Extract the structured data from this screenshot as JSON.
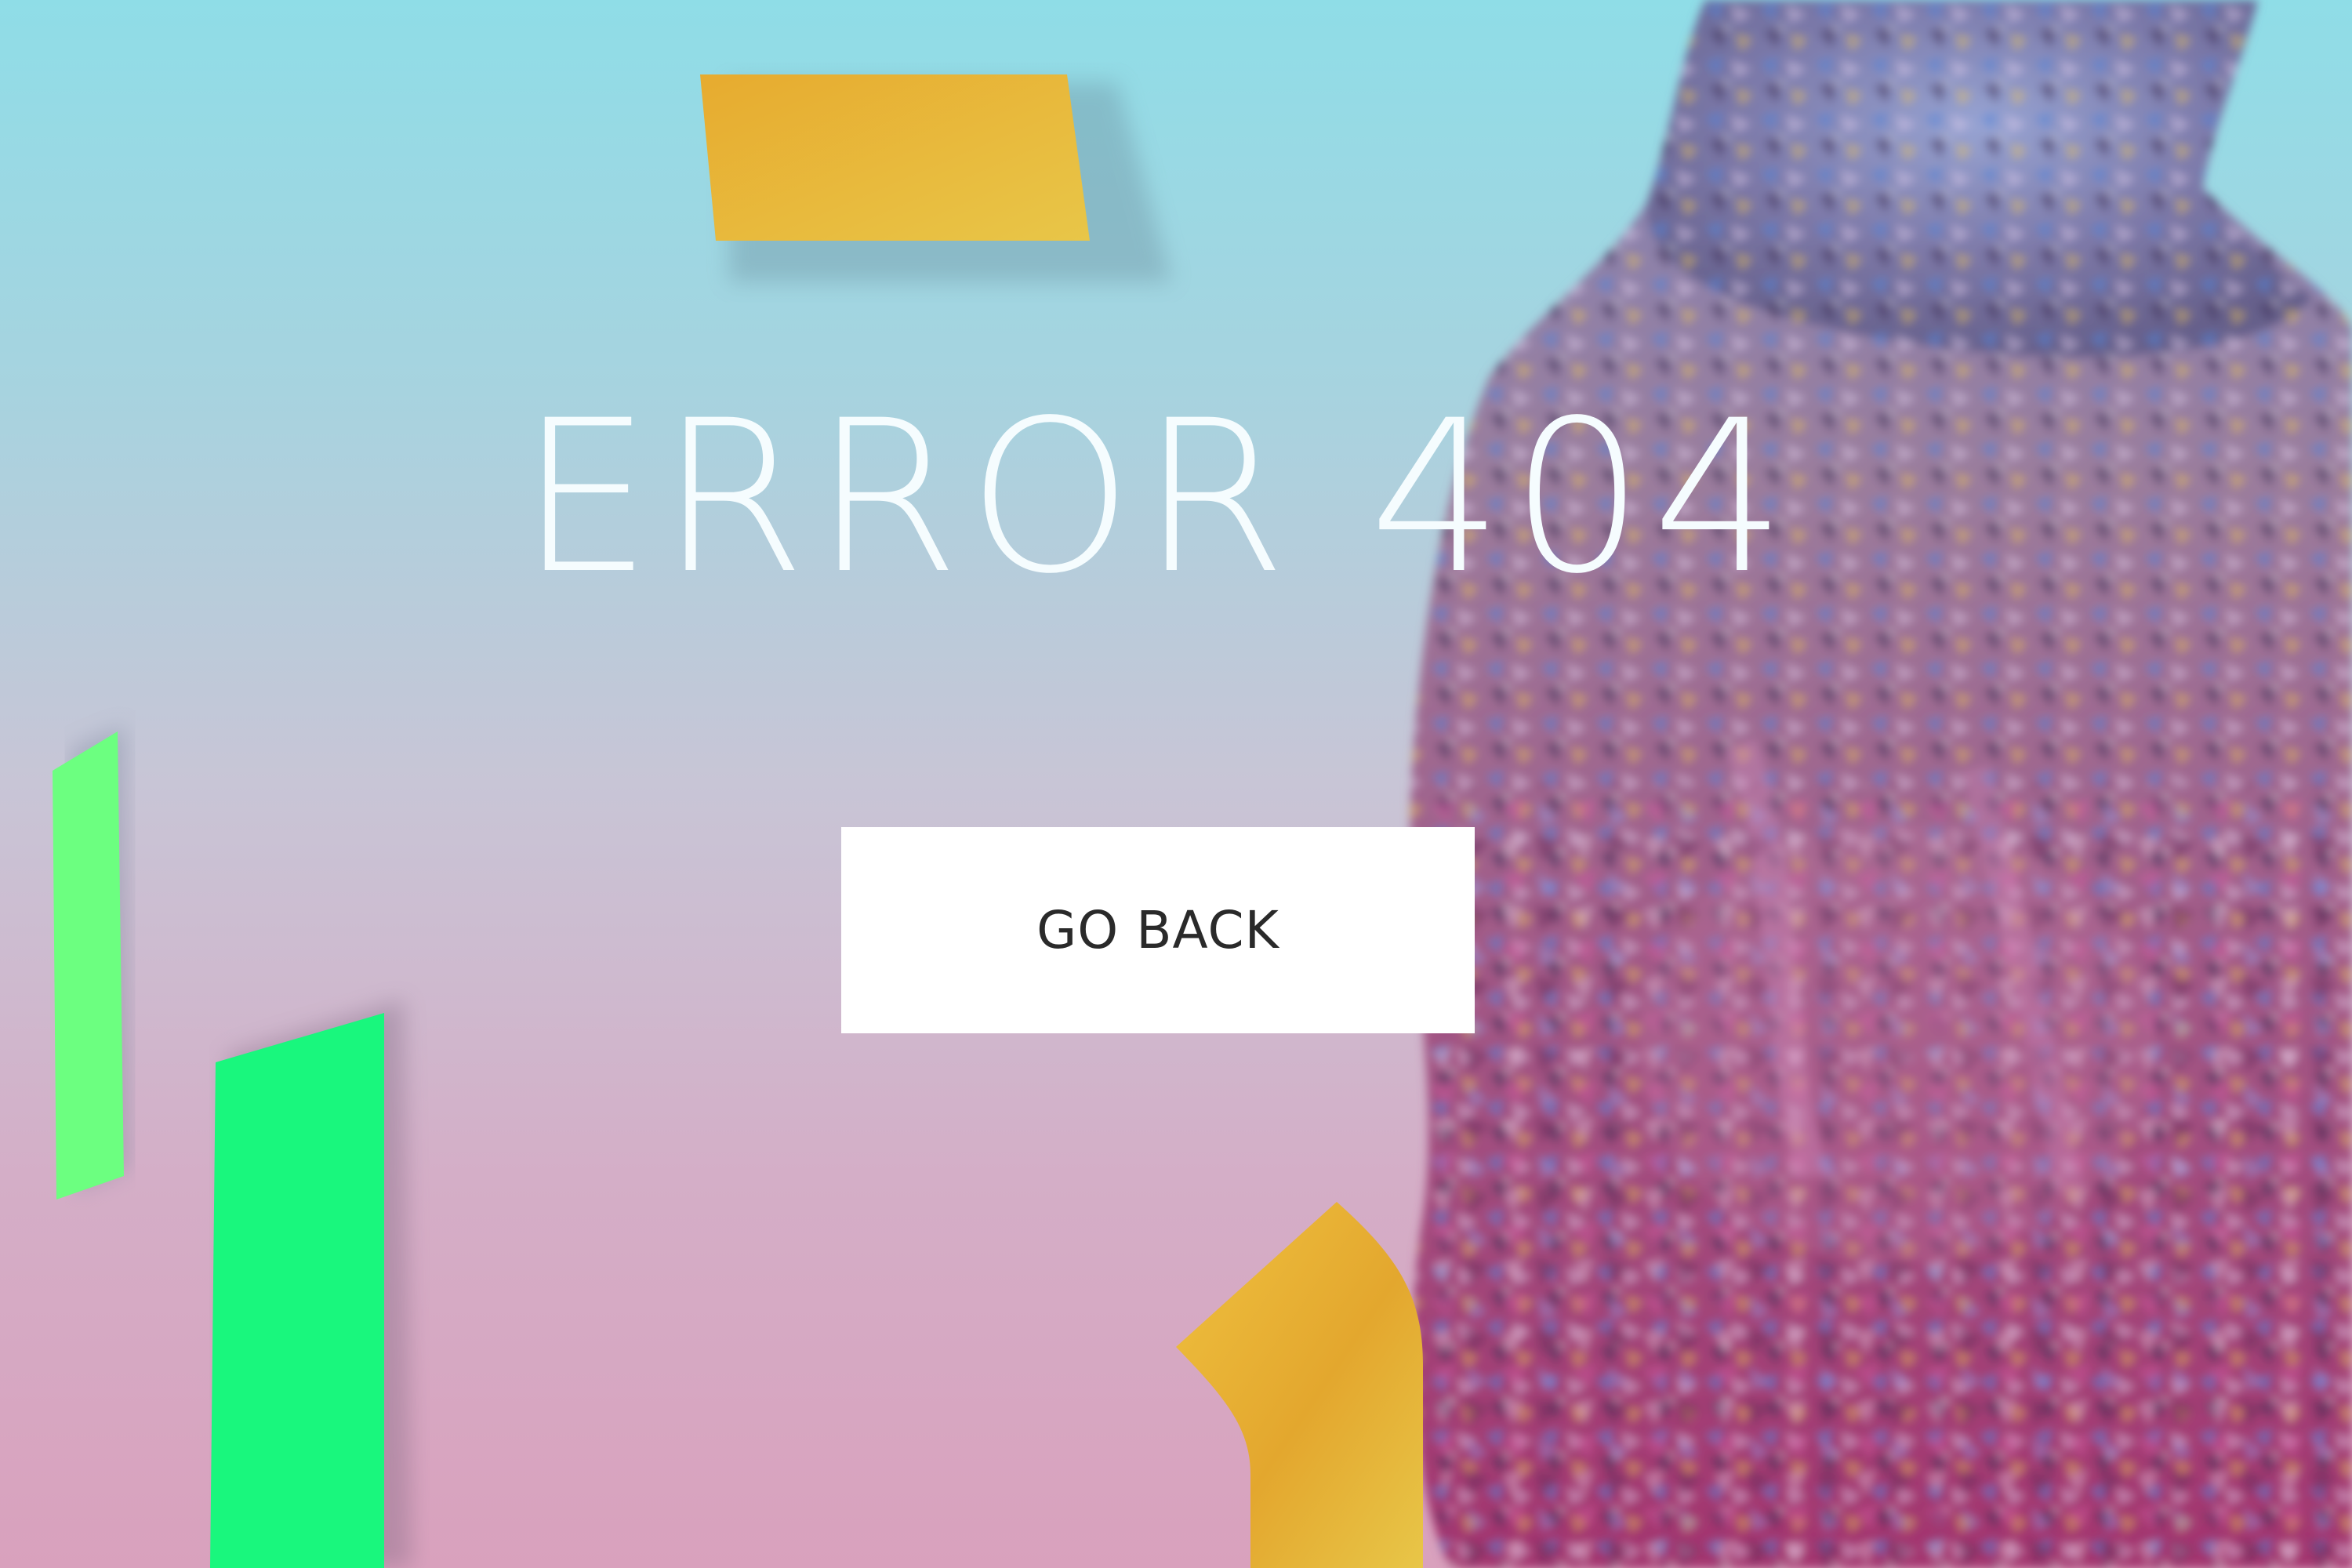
{
  "error": {
    "heading": "ERROR 404",
    "back_button_label": "GO BACK"
  },
  "colors": {
    "background_top": "#8fdde7",
    "background_bottom": "#d9a1bd",
    "heading_text": "#f5fcfe",
    "button_background": "#ffffff",
    "button_text": "#2a2a2a",
    "accent_yellow": "#e8b836",
    "accent_green": "#19f77d",
    "accent_green_light": "#6cff80"
  },
  "decorations": {
    "hero_image": "butterfly-dress-figure",
    "shapes": [
      "yellow-parallelogram-top",
      "green-bar-left",
      "green-bar-bottom-left",
      "yellow-ribbon-bottom"
    ]
  }
}
